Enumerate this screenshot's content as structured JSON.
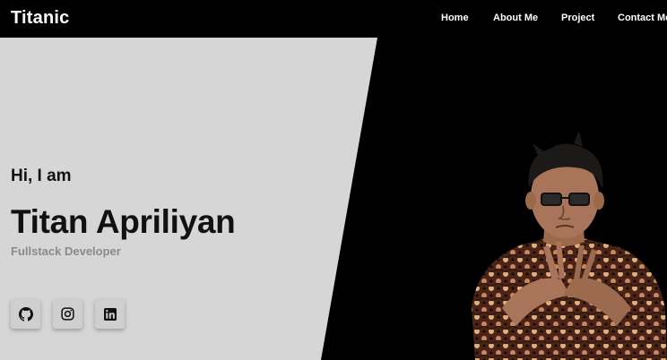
{
  "brand": "Titanic",
  "nav": {
    "home": "Home",
    "about": "About Me",
    "project": "Project",
    "contact": "Contact Me"
  },
  "hero": {
    "greeting": "Hi, I am",
    "name": "Titan Apriliyan",
    "role": "Fullstack Developer"
  },
  "social": {
    "icons": [
      "github-icon",
      "instagram-icon",
      "linkedin-icon"
    ]
  },
  "colors": {
    "nav_bg": "#000000",
    "panel_gray": "#d6d6d6",
    "hero_right": "#000000",
    "role_text": "#8a8a8a",
    "button_bg": "#cfcfcf"
  }
}
